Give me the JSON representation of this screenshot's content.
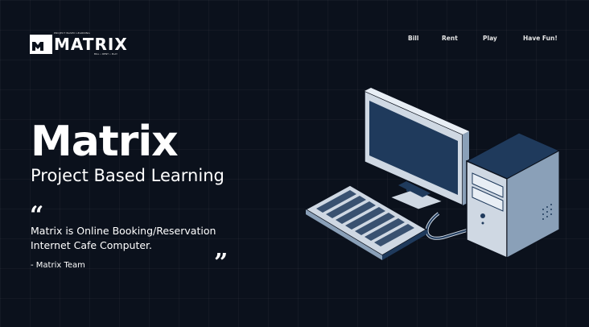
{
  "logo": {
    "text": "MATRIX",
    "tagline_top": "PROJECT BASED LEARNING",
    "tagline_bottom": "BILL • RENT • PLAY"
  },
  "nav": {
    "items": [
      {
        "label": "Bill"
      },
      {
        "label": "Rent"
      },
      {
        "label": "Play"
      },
      {
        "label": "Have Fun!"
      }
    ]
  },
  "hero": {
    "title": "Matrix",
    "subtitle": "Project Based Learning",
    "quote_open": "“",
    "quote_close": "”",
    "quote": "Matrix is Online Booking/Reservation Internet Cafe Computer.",
    "author": "- Matrix Team"
  },
  "colors": {
    "background": "#0b111c",
    "illustration_dark": "#1f3a5c",
    "illustration_light": "#cfd8e3"
  }
}
